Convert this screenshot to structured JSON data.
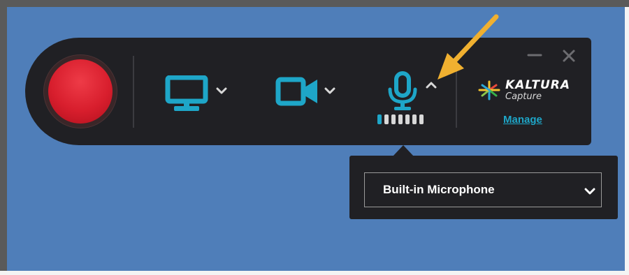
{
  "recorder": {
    "record_label": "Record",
    "sources": [
      {
        "name": "screen",
        "icon": "monitor-icon"
      },
      {
        "name": "camera",
        "icon": "video-camera-icon"
      },
      {
        "name": "microphone",
        "icon": "microphone-icon",
        "level_bars": 7,
        "active_bars": 1
      }
    ],
    "window_controls": {
      "minimize": "—",
      "close": "✕"
    }
  },
  "brand": {
    "name": "KALTURA",
    "sub": "Capture",
    "manage_label": "Manage"
  },
  "mic_popup": {
    "selected_device": "Built-in Microphone"
  },
  "colors": {
    "accent": "#1ea6c8",
    "toolbar_bg": "#202024",
    "record": "#d81e2d",
    "desktop": "#4f7eb9",
    "annotation_arrow": "#f0b030"
  }
}
